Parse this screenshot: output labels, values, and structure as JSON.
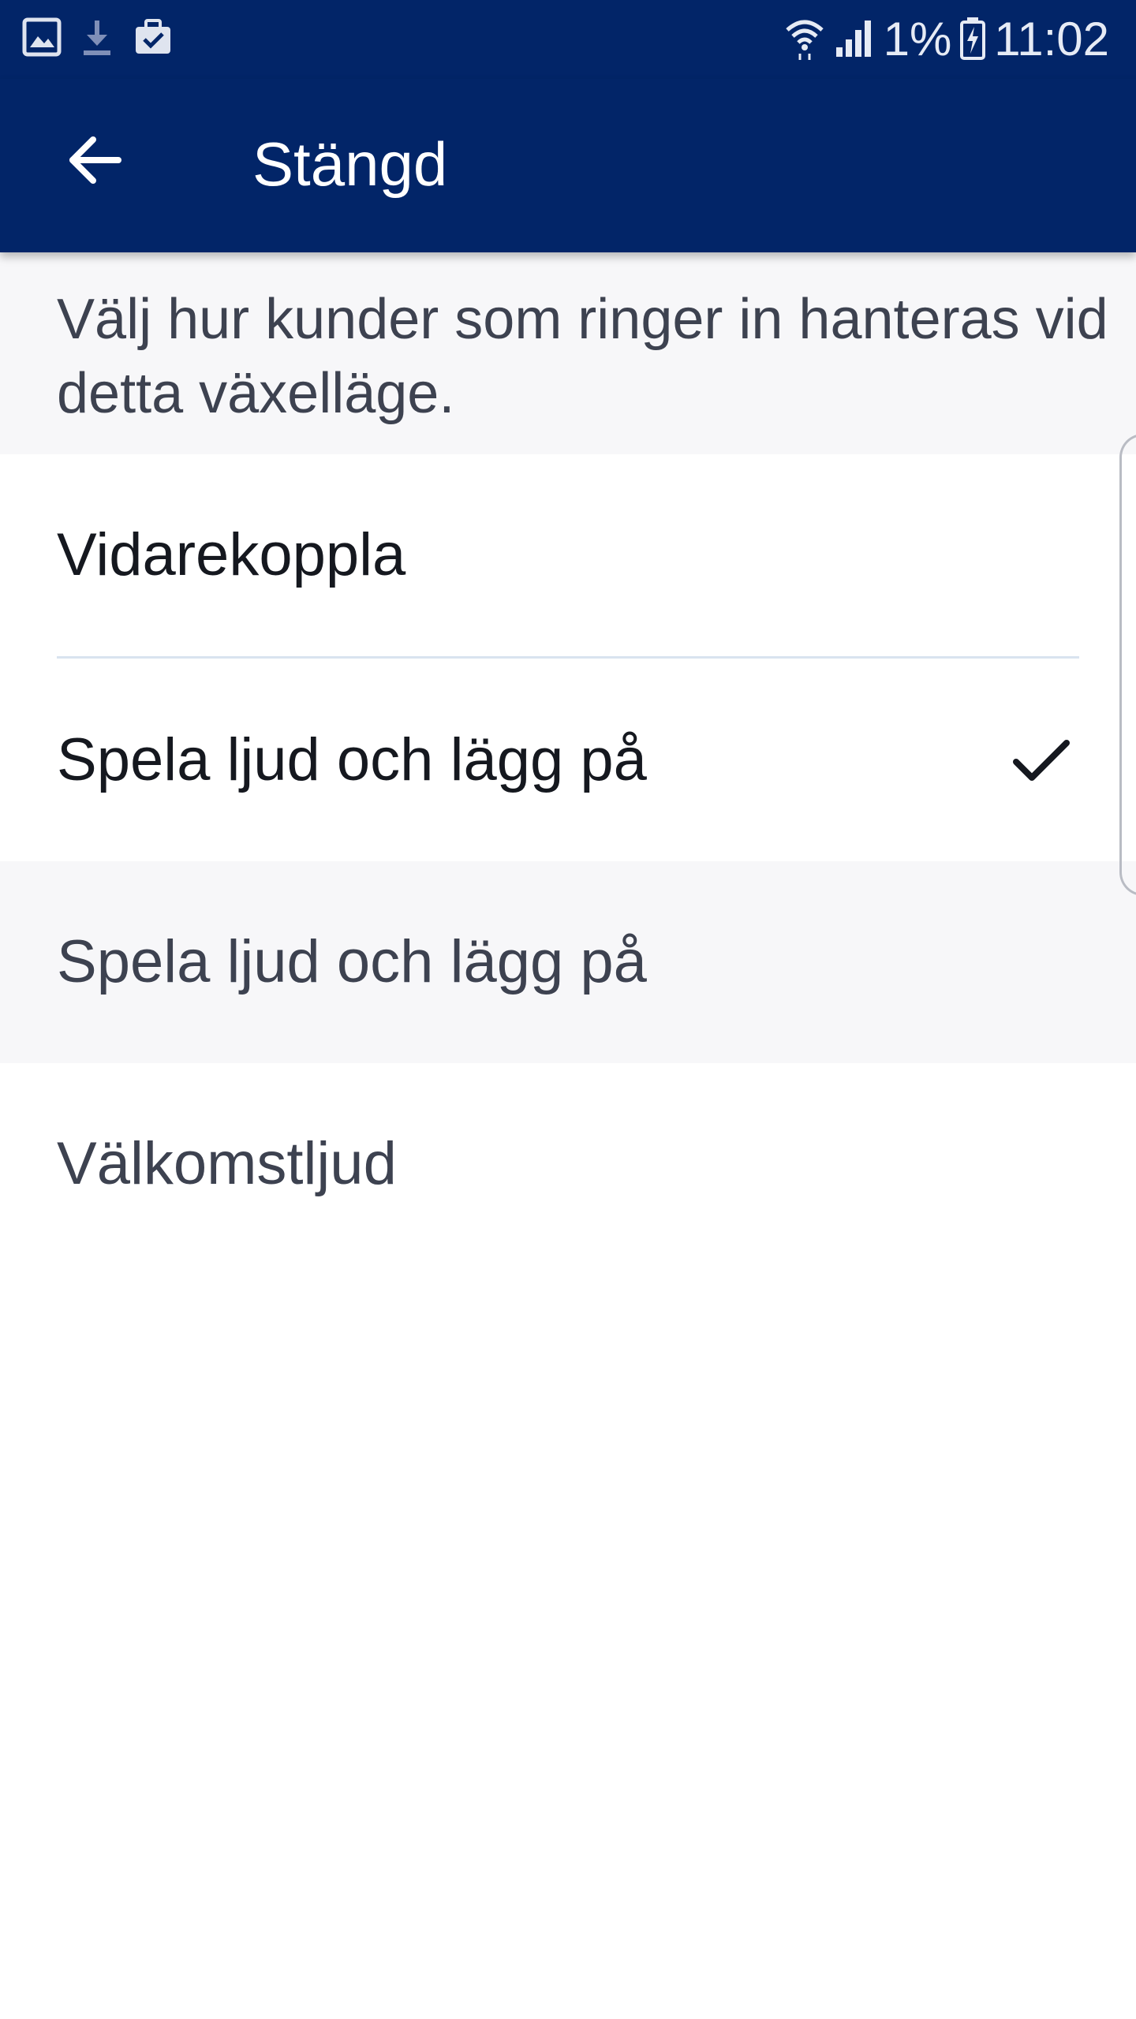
{
  "status_bar": {
    "icons_left": [
      "gallery-icon",
      "download-icon",
      "work-briefcase-icon"
    ],
    "icons_right": [
      "wifi-icon",
      "signal-icon",
      "battery-charging-icon"
    ],
    "battery_percent": "1%",
    "time": "11:02"
  },
  "app_bar": {
    "back_icon": "arrow-left-icon",
    "title": "Stängd"
  },
  "description": "Välj hur kunder som ringer in hanteras vid detta växelläge.",
  "options": [
    {
      "label": "Vidarekoppla",
      "selected": false
    },
    {
      "label": "Spela ljud och lägg på",
      "selected": true
    }
  ],
  "section": {
    "header": "Spela ljud och lägg på",
    "items": [
      {
        "label": "Välkomstljud"
      }
    ]
  },
  "colors": {
    "primary": "#022568",
    "background_light": "#f7f7f9",
    "text_primary": "#15181f",
    "text_secondary": "#3d4250",
    "divider": "#d9e3ef"
  }
}
